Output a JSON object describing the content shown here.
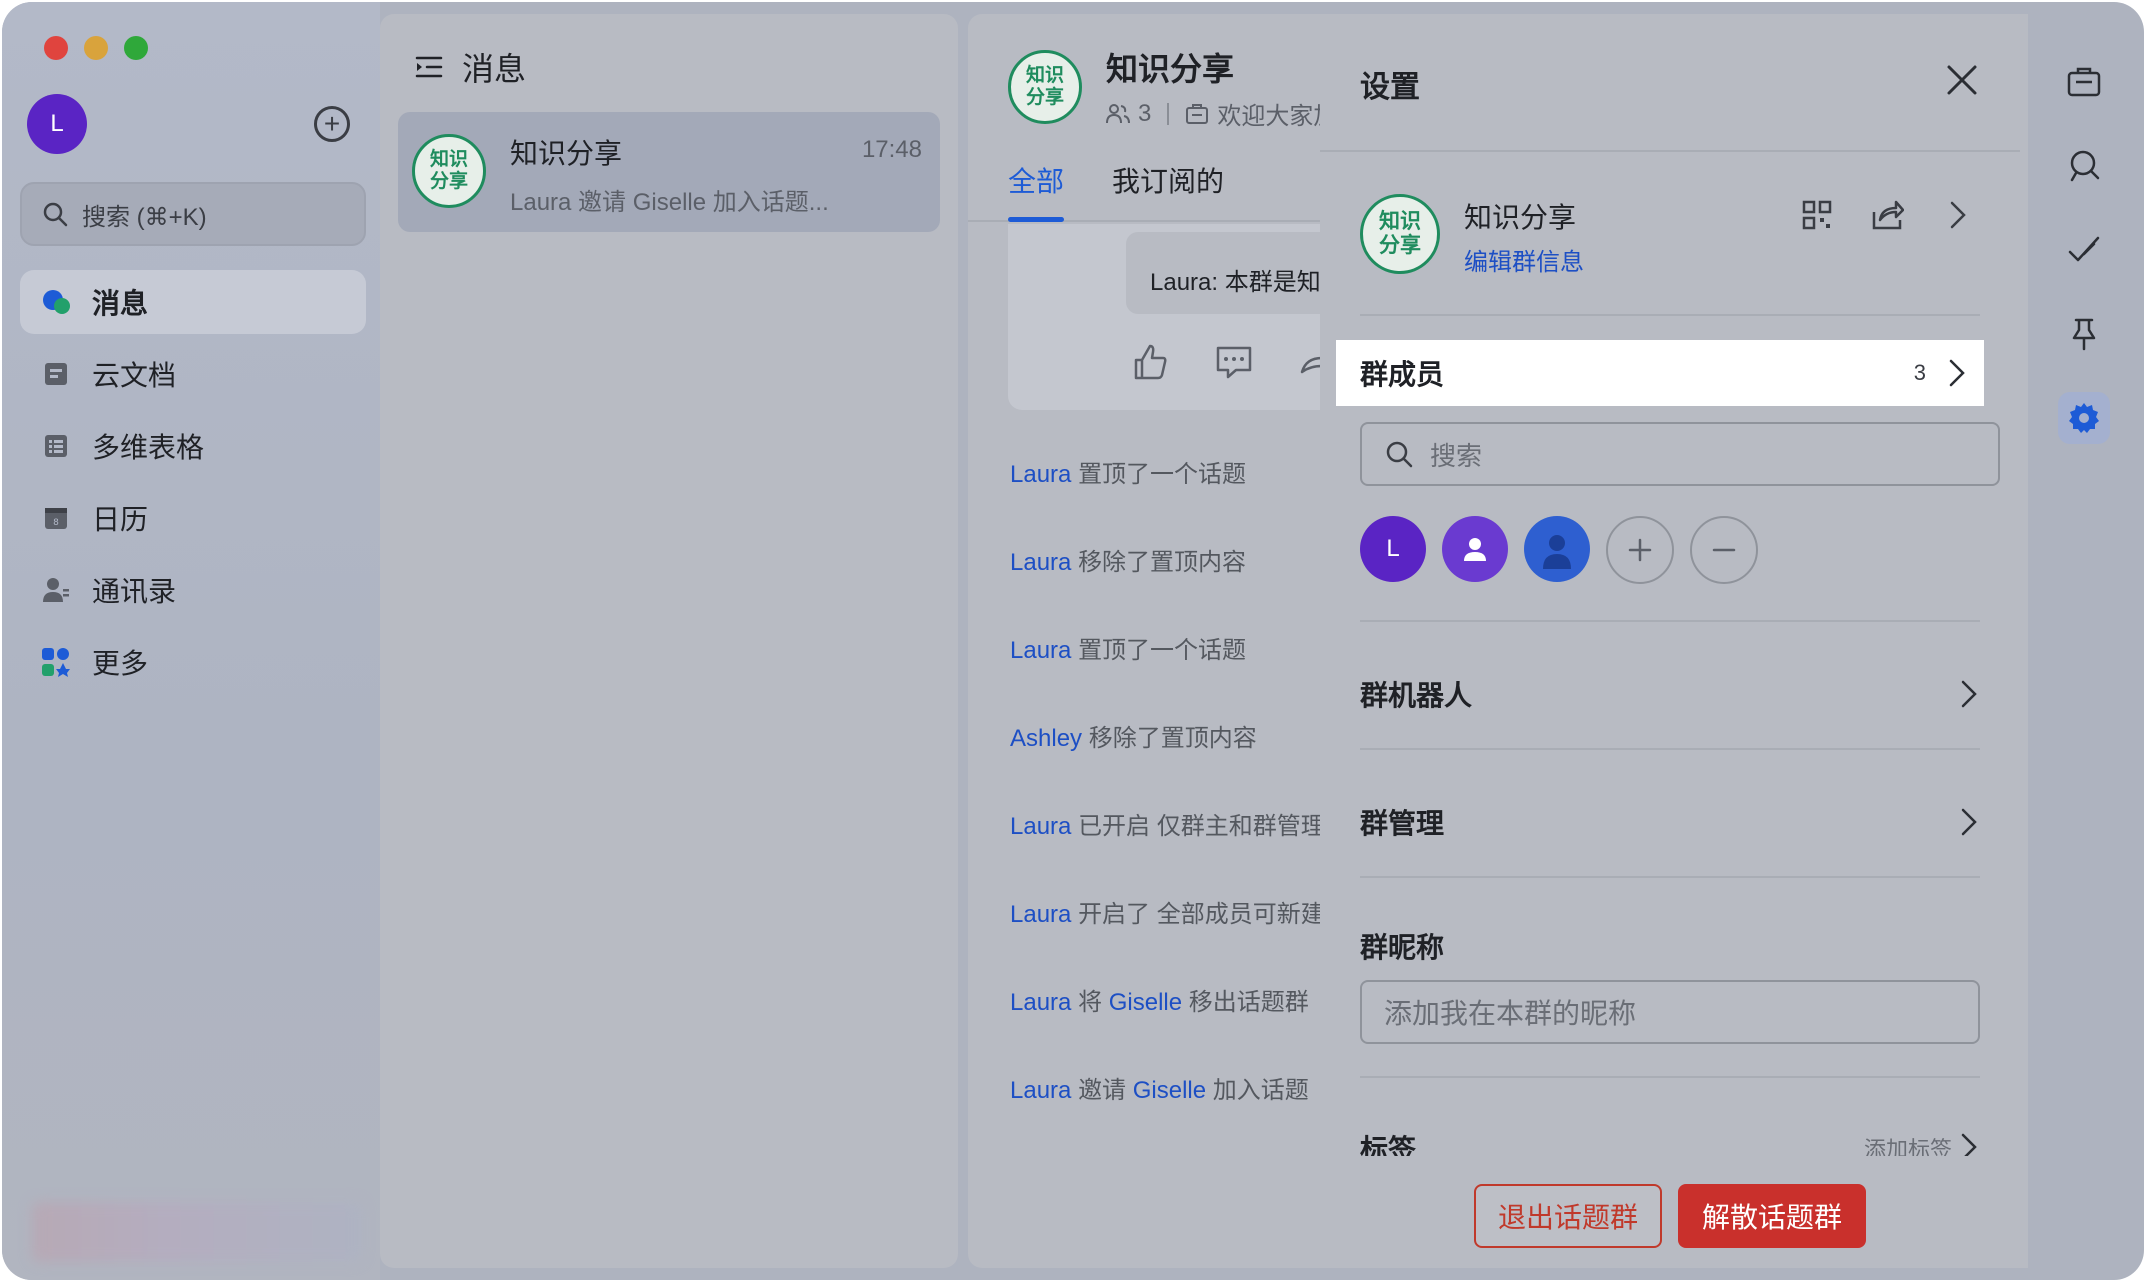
{
  "me": {
    "avatar_letter": "L"
  },
  "sidebar": {
    "search_placeholder": "搜索 (⌘+K)",
    "items": [
      {
        "label": "消息",
        "icon": "chat-bubble-icon",
        "active": true
      },
      {
        "label": "云文档",
        "icon": "cloud-doc-icon"
      },
      {
        "label": "多维表格",
        "icon": "table-icon"
      },
      {
        "label": "日历",
        "icon": "calendar-icon"
      },
      {
        "label": "通讯录",
        "icon": "contacts-icon"
      },
      {
        "label": "更多",
        "icon": "more-apps-icon"
      }
    ]
  },
  "chatlist": {
    "title": "消息",
    "chats": [
      {
        "avatar_text": "知识\n分享",
        "name": "知识分享",
        "time": "17:48",
        "preview": "Laura 邀请 Giselle 加入话题..."
      }
    ]
  },
  "chat": {
    "avatar_text": "知识\n分享",
    "title": "知识分享",
    "member_count": "3",
    "announcement": "欢迎大家加",
    "tabs": [
      "全部",
      "我订阅的"
    ],
    "card_message": "Laura: 本群是知识分享",
    "system_lines": [
      {
        "user": "Laura",
        "text": "置顶了一个话题"
      },
      {
        "user": "Laura",
        "text": "移除了置顶内容"
      },
      {
        "user": "Laura",
        "text": "置顶了一个话题"
      },
      {
        "user": "Ashley",
        "text": "移除了置顶内容"
      },
      {
        "user": "Laura",
        "text": "已开启 仅群主和群管理"
      },
      {
        "user": "Laura",
        "text": "开启了 全部成员可新建"
      },
      {
        "user": "Laura",
        "text": "将",
        "user2": "Giselle",
        "text2": "移出话题群"
      },
      {
        "user": "Laura",
        "text": "邀请",
        "user2": "Giselle",
        "text2": "加入话题"
      }
    ]
  },
  "settings": {
    "title": "设置",
    "group_name": "知识分享",
    "group_avatar_text": "知识\n分享",
    "edit_info": "编辑群信息",
    "members_label": "群成员",
    "members_count": "3",
    "member_search_placeholder": "搜索",
    "member_avatars": [
      "L",
      "",
      ""
    ],
    "bots_label": "群机器人",
    "manage_label": "群管理",
    "nickname_label": "群昵称",
    "nickname_placeholder": "添加我在本群的昵称",
    "tags_label": "标签",
    "tags_action": "添加标签",
    "quit_button": "退出话题群",
    "dissolve_button": "解散话题群"
  },
  "colors": {
    "accent": "#1d5bd6",
    "danger": "#c9302c",
    "group_green": "#1f8c5e",
    "avatar_purple": "#5a24c4"
  }
}
